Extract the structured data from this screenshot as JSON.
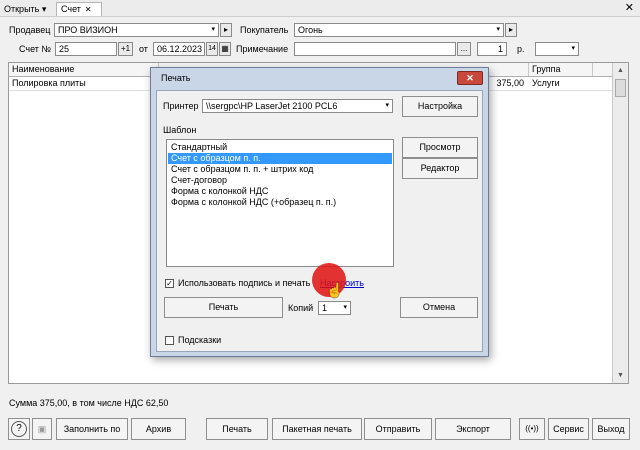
{
  "topbar": {
    "open_label": "Открыть ▾",
    "tab_label": "Счет",
    "tab_close": "✕",
    "close": "✕"
  },
  "form": {
    "seller_label": "Продавец",
    "seller_value": "ПРО ВИЗИОН",
    "buyer_label": "Покупатель",
    "buyer_value": "Огонь",
    "invoice_label": "Счет №",
    "invoice_value": "25",
    "plus_one": "+1",
    "from_label": "от",
    "date_value": "06.12.2023",
    "day_btn": "14",
    "note_label": "Примечание",
    "note_value": "",
    "ellipsis": "...",
    "count_value": "1",
    "currency": "р.",
    "arrow_right": "▸",
    "arrow_down": "▾"
  },
  "grid": {
    "headers": [
      "Наименование",
      "Группа"
    ],
    "rows": [
      {
        "name": "Полировка плиты",
        "amount": "375,00",
        "group": "Услуги"
      }
    ]
  },
  "summary": "Сумма 375,00, в том числе НДС 62,50",
  "toolbar": {
    "help": "?",
    "save": "▣",
    "fill": "Заполнить по",
    "archive": "Архив",
    "print": "Печать",
    "batch": "Пакетная печать",
    "send": "Отправить",
    "export": "Экспорт",
    "radio": "((•))",
    "service": "Сервис",
    "exit": "Выход"
  },
  "dialog": {
    "title": "Печать",
    "close": "✕",
    "printer_label": "Принтер",
    "printer_value": "\\\\sergpc\\HP LaserJet 2100 PCL6",
    "settings_btn": "Настройка",
    "template_label": "Шаблон",
    "templates": [
      "Стандартный",
      "Счет с образцом п. п.",
      "Счет с образцом п. п. + штрих код",
      "Счет-договор",
      "Форма с колонкой НДС",
      "Форма с колонкой НДС (+образец п. п.)"
    ],
    "selected_index": 1,
    "preview_btn": "Просмотр",
    "editor_btn": "Редактор",
    "use_signature_label": "Использовать подпись и печать",
    "configure_link": "Настроить",
    "print_btn": "Печать",
    "copies_label": "Копий",
    "copies_value": "1",
    "cancel_btn": "Отмена",
    "hints_label": "Подсказки",
    "check_mark": "✓"
  }
}
